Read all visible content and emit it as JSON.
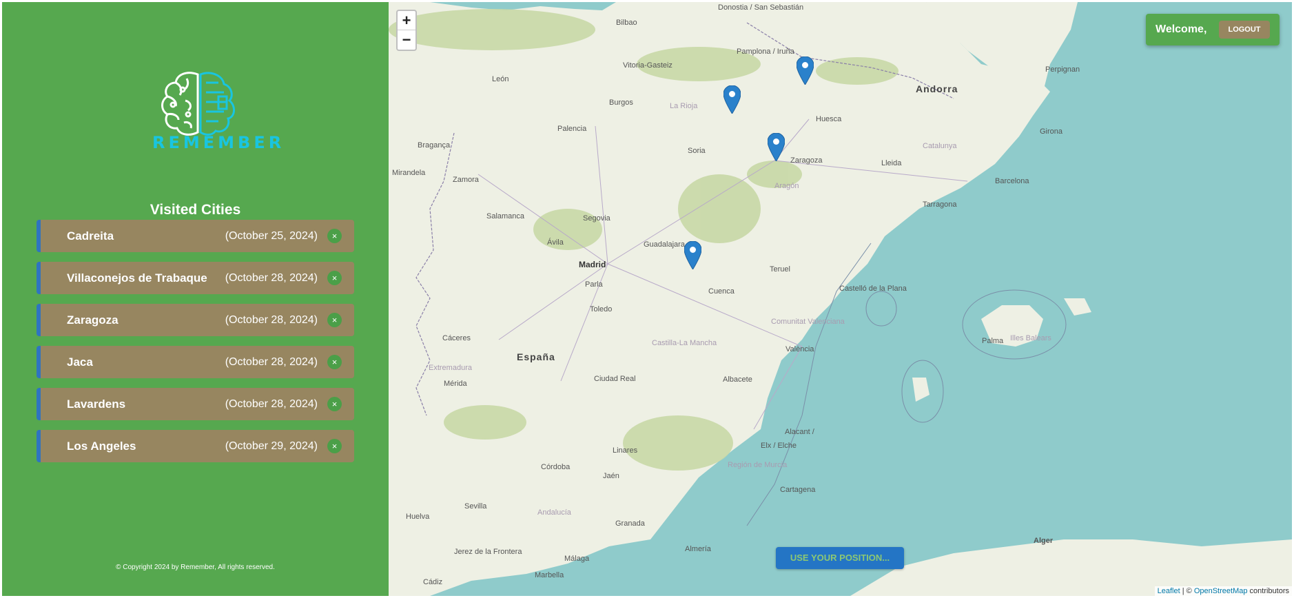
{
  "sidebar": {
    "logo_text": "REMEMBER",
    "list_title": "Visited Cities",
    "cities": [
      {
        "name": "Cadreita",
        "date": "(October 25, 2024)",
        "remove": "×"
      },
      {
        "name": "Villaconejos de Trabaque",
        "date": "(October 28, 2024)",
        "remove": "×"
      },
      {
        "name": "Zaragoza",
        "date": "(October 28, 2024)",
        "remove": "×"
      },
      {
        "name": "Jaca",
        "date": "(October 28, 2024)",
        "remove": "×"
      },
      {
        "name": "Lavardens",
        "date": "(October 28, 2024)",
        "remove": "×"
      },
      {
        "name": "Los Angeles",
        "date": "(October 29, 2024)",
        "remove": "×"
      }
    ],
    "copyright": "© Copyright 2024 by Remember, All rights reserved."
  },
  "map": {
    "zoom_in": "+",
    "zoom_out": "−",
    "welcome": "Welcome,",
    "logout": "LOGOUT",
    "use_position": "USE YOUR POSITION...",
    "attribution": {
      "leaflet": "Leaflet",
      "sep": " | © ",
      "osm": "OpenStreetMap",
      "contrib": " contributors"
    },
    "labels": {
      "madrid": "Madrid",
      "espana": "España",
      "andorra": "Andorra",
      "zaragoza": "Zaragoza",
      "valencia": "València",
      "barcelona": "Barcelona",
      "bilbao": "Bilbao",
      "burgos": "Burgos",
      "toledo": "Toledo",
      "cuenca": "Cuenca",
      "huesca": "Huesca",
      "lleida": "Lleida",
      "tarragona": "Tarragona",
      "teruel": "Teruel",
      "albacete": "Albacete",
      "alicante": "Alacant /",
      "palma": "Palma",
      "illes": "Illes Balears",
      "granada": "Granada",
      "sevilla": "Sevilla",
      "cordoba": "Córdoba",
      "malaga": "Málaga",
      "almeria": "Almería",
      "murcia": "Región de Murcia",
      "cartagena": "Cartagena",
      "salamanca": "Salamanca",
      "segovia": "Segovia",
      "guadalajara": "Guadalajara",
      "soria": "Soria",
      "leon": "León",
      "palencia": "Palencia",
      "zamora": "Zamora",
      "caceres": "Cáceres",
      "merida": "Mérida",
      "ciudadreal": "Ciudad Real",
      "jaen": "Jaén",
      "linares": "Linares",
      "girona": "Girona",
      "perpignan": "Perpignan",
      "alger": "Alger",
      "aragon": "Aragón",
      "castillalamancha": "Castilla-La Mancha",
      "andalucia": "Andalucía",
      "cataluna": "Catalunya",
      "extremadura": "Extremadura",
      "comunitat": "Comunitat Valenciana",
      "pamplona": "Pamplona / Iruña",
      "vitoria": "Vitoria-Gasteiz",
      "donostia": "Donostia / San Sebastián",
      "larioja": "La Rioja",
      "castellon": "Castelló de la Plana",
      "elche": "Elx / Elche",
      "huelva": "Huelva",
      "cadiz": "Cádiz",
      "marbella": "Marbella",
      "jerez": "Jerez de la Frontera",
      "avila": "Ávila",
      "parla": "Parla",
      "braganca": "Bragança",
      "mirandela": "Mirandela"
    }
  }
}
